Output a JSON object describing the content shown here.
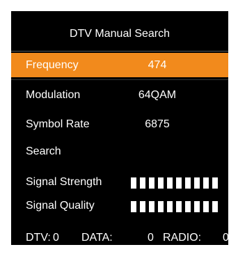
{
  "screen": {
    "title": "DTV Manual Search"
  },
  "menu": {
    "frequency": {
      "label": "Frequency",
      "value": "474",
      "selected": true
    },
    "modulation": {
      "label": "Modulation",
      "value": "64QAM"
    },
    "symbol_rate": {
      "label": "Symbol Rate",
      "value": "6875"
    },
    "search": {
      "label": "Search"
    }
  },
  "signal": {
    "strength": {
      "label": "Signal Strength",
      "level": 10,
      "max": 10
    },
    "quality": {
      "label": "Signal Quality",
      "level": 10,
      "max": 10
    }
  },
  "results": {
    "dtv": {
      "label": "DTV:",
      "count": "0"
    },
    "data": {
      "label": "DATA:",
      "count": "0"
    },
    "radio": {
      "label": "RADIO:",
      "count": "0"
    }
  },
  "colors": {
    "background": "#000000",
    "selected_highlight": "#f28a1c",
    "text": "#ffffff"
  }
}
